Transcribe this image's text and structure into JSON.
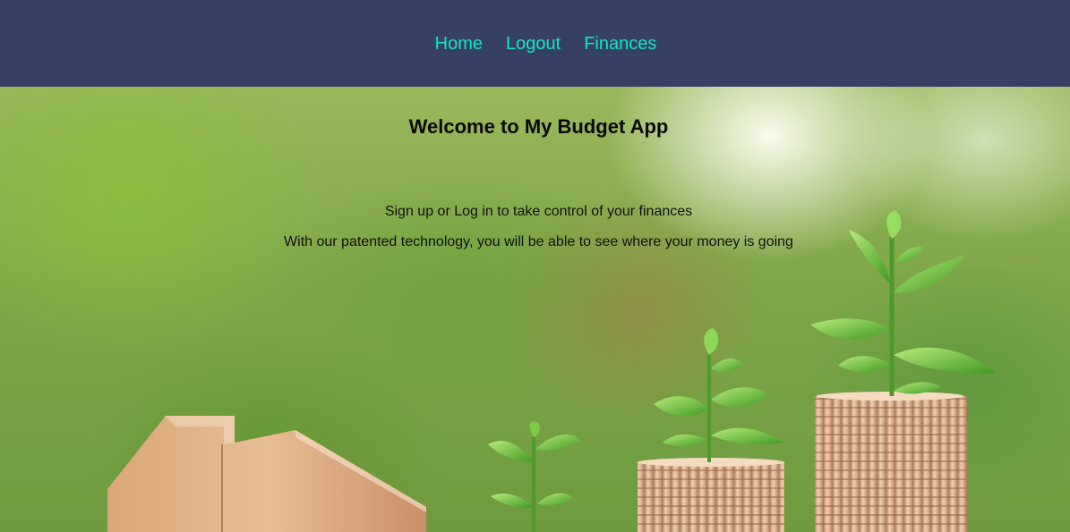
{
  "navbar": {
    "links": [
      {
        "label": "Home"
      },
      {
        "label": "Logout"
      },
      {
        "label": "Finances"
      }
    ],
    "background": "#364065",
    "link_color": "#13e6bd"
  },
  "hero": {
    "title": "Welcome to My Budget App",
    "line1": "Sign up or Log in to take control of your finances",
    "line2": "With our patented technology, you will be able to see where your money is going",
    "image_subject": "wooden house cutout and coin stacks with green seedlings"
  }
}
